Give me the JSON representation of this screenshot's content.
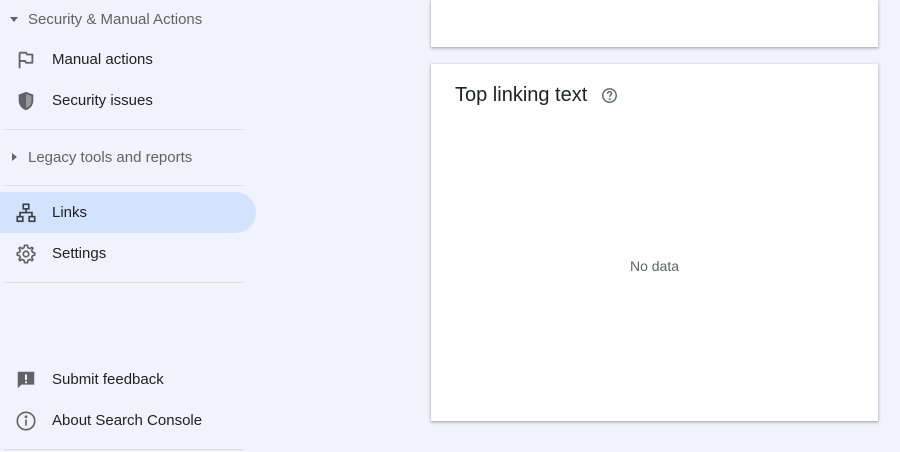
{
  "sidebar": {
    "security_section": {
      "label": "Security & Manual Actions",
      "expanded": true
    },
    "manual_actions": {
      "label": "Manual actions",
      "icon": "flag-icon"
    },
    "security_issues": {
      "label": "Security issues",
      "icon": "shield-icon"
    },
    "legacy_section": {
      "label": "Legacy tools and reports",
      "expanded": false
    },
    "links": {
      "label": "Links",
      "icon": "links-icon",
      "active": true
    },
    "settings": {
      "label": "Settings",
      "icon": "gear-icon"
    },
    "submit_feedback": {
      "label": "Submit feedback",
      "icon": "feedback-icon"
    },
    "about": {
      "label": "About Search Console",
      "icon": "info-icon"
    }
  },
  "main": {
    "linking_text_card": {
      "title": "Top linking text",
      "empty_message": "No data"
    }
  },
  "colors": {
    "background": "#f1f3fc",
    "active_item": "#d3e3fd",
    "icon": "#5f6368",
    "text": "#202124"
  }
}
